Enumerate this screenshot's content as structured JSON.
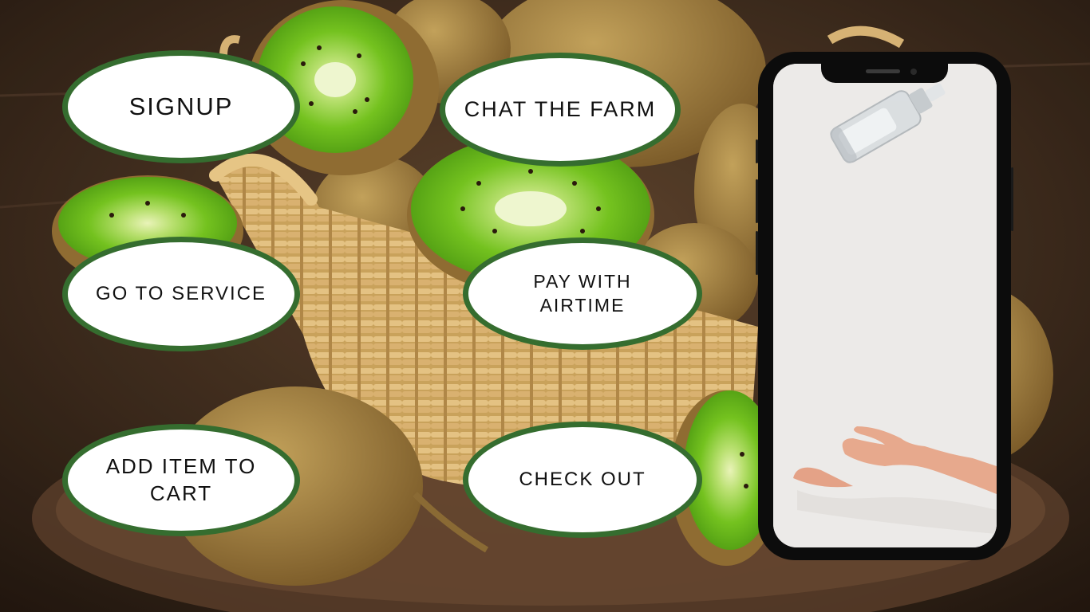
{
  "buttons": {
    "signup": "SIGNUP",
    "chat_the_farm": "CHAT THE FARM",
    "go_to_service": "GO TO SERVICE",
    "pay_with_airtime_line1": "PAY WITH",
    "pay_with_airtime_line2": "AIRTIME",
    "add_item_to_cart_line1": "ADD ITEM TO",
    "add_item_to_cart_line2": "CART",
    "check_out": "CHECK OUT"
  },
  "colors": {
    "pill_border": "#356d2f",
    "pill_fill": "#ffffff",
    "phone_frame": "#0c0c0c",
    "phone_screen": "#eceae8",
    "kiwi_flesh": "#7cc22a",
    "kiwi_skin": "#9c7a3c",
    "basket": "#d7b06a",
    "wood": "#4a3424"
  },
  "icons": {
    "phone": "smartphone-icon",
    "bottle": "spray-bottle-icon",
    "hand": "hand-icon"
  }
}
